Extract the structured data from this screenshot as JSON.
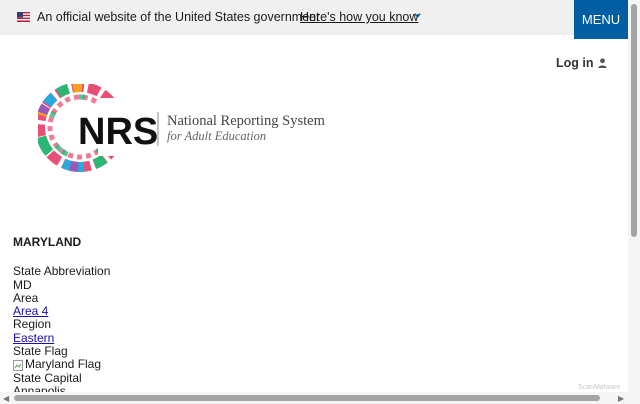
{
  "banner": {
    "text": "An official website of the United States government",
    "link": "Here's how you know"
  },
  "menu": {
    "label": "MENU"
  },
  "login": {
    "label": "Log in"
  },
  "logo": {
    "mark": "NRS",
    "line1": "National Reporting System",
    "line2": "for Adult Education"
  },
  "state": {
    "name": "MARYLAND",
    "abbr_label": "State Abbreviation",
    "abbr_value": "MD",
    "area_label": "Area",
    "area_value": "Area 4",
    "region_label": "Region",
    "region_value": "Eastern",
    "flag_label": "State Flag",
    "flag_alt": "Maryland Flag",
    "capital_label": "State Capital",
    "capital_value": "Annapolis"
  },
  "watermark": "ScanMalware",
  "colors": {
    "menu_bg": "#005ea2",
    "link": "#1a0dab",
    "banner_bg": "#f0f0f0"
  }
}
